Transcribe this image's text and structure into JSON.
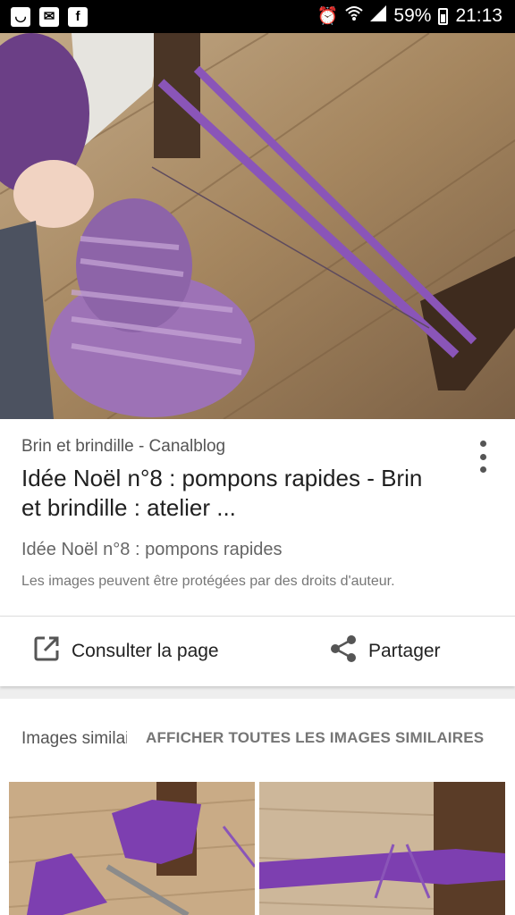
{
  "status_bar": {
    "battery": "59%",
    "time": "21:13"
  },
  "result": {
    "source": "Brin et brindille - Canalblog",
    "title": "Idée Noël n°8 : pompons rapides - Brin et brindille : atelier ...",
    "subtitle": "Idée Noël n°8 : pompons rapides",
    "copyright": "Les images peuvent être protégées par des droits d'auteur."
  },
  "actions": {
    "open_label": "Consulter la page",
    "share_label": "Partager"
  },
  "similar": {
    "label": "Images similaires",
    "show_all": "AFFICHER TOUTES LES IMAGES SIMILAIRES"
  }
}
